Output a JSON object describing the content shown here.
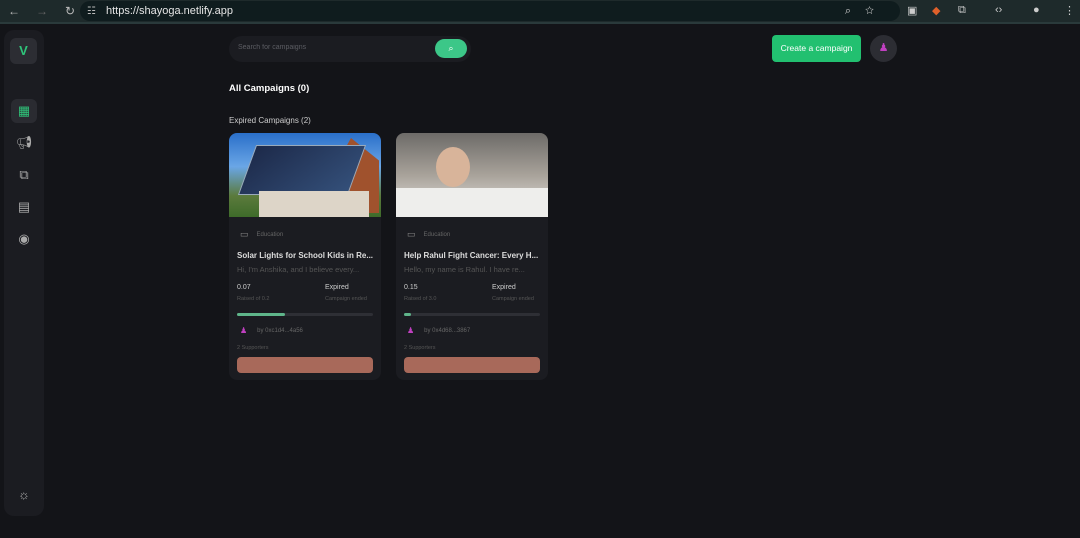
{
  "browser": {
    "url": "https://shayoga.netlify.app"
  },
  "search": {
    "placeholder": "Search for campaigns"
  },
  "header": {
    "create_label": "Create a campaign"
  },
  "sidebar": {
    "logo": "V",
    "items": [
      {
        "icon": "grid-icon",
        "active": true
      },
      {
        "icon": "megaphone-icon"
      },
      {
        "icon": "payments-icon"
      },
      {
        "icon": "archive-icon"
      },
      {
        "icon": "user-circle-icon"
      }
    ],
    "theme_icon": "sun-icon"
  },
  "main": {
    "all_title": "All Campaigns (0)",
    "expired_title": "Expired Campaigns (2)",
    "campaigns": [
      {
        "category": "Education",
        "title": "Solar Lights for School Kids in Re...",
        "description": "Hi, I'm Anshika, and I believe every...",
        "raised": "0.07",
        "raised_label": "Raised of 0.2",
        "status": "Expired",
        "status_sub": "Campaign ended",
        "progress_percent": 35,
        "owner": "by 0xc1d4...4a56",
        "supporters": "2 Supporters"
      },
      {
        "category": "Education",
        "title": "Help Rahul Fight Cancer: Every H...",
        "description": "Hello, my name is Rahul. I have re...",
        "raised": "0.15",
        "raised_label": "Raised of 3.0",
        "status": "Expired",
        "status_sub": "Campaign ended",
        "progress_percent": 5,
        "owner": "by 0x4d68...3867",
        "supporters": "2 Supporters"
      }
    ]
  },
  "colors": {
    "accent": "#22c070",
    "action": "#a8695a",
    "background": "#131418"
  }
}
